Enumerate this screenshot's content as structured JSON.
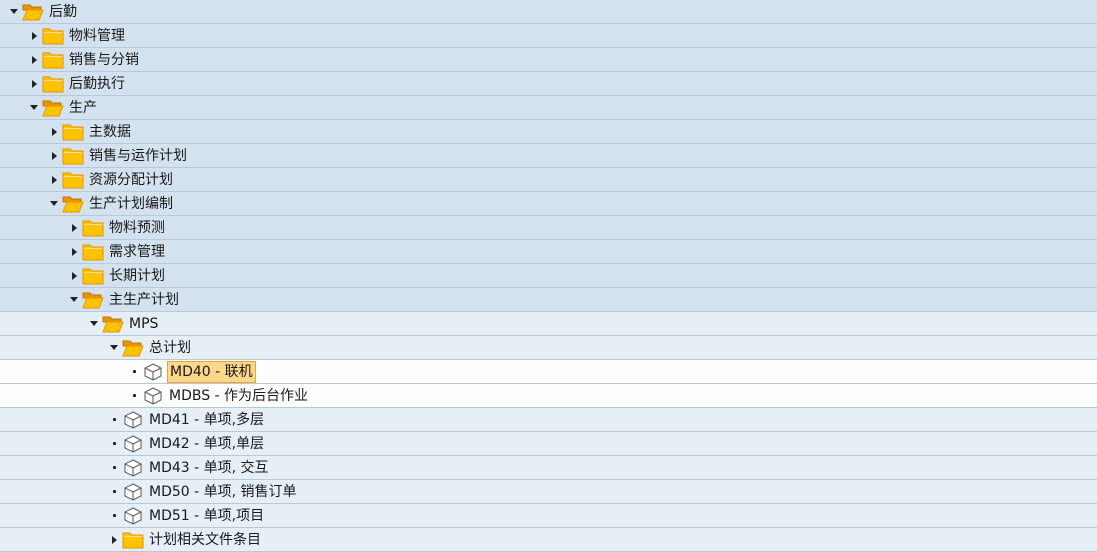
{
  "tree": [
    {
      "label": "后勤",
      "type": "folder",
      "state": "open",
      "level": 0
    },
    {
      "label": "物料管理",
      "type": "folder",
      "state": "closed",
      "level": 1
    },
    {
      "label": "销售与分销",
      "type": "folder",
      "state": "closed",
      "level": 1
    },
    {
      "label": "后勤执行",
      "type": "folder",
      "state": "closed",
      "level": 1
    },
    {
      "label": "生产",
      "type": "folder",
      "state": "open",
      "level": 1
    },
    {
      "label": "主数据",
      "type": "folder",
      "state": "closed",
      "level": 2
    },
    {
      "label": "销售与运作计划",
      "type": "folder",
      "state": "closed",
      "level": 2
    },
    {
      "label": "资源分配计划",
      "type": "folder",
      "state": "closed",
      "level": 2
    },
    {
      "label": "生产计划编制",
      "type": "folder",
      "state": "open",
      "level": 2
    },
    {
      "label": "物料预测",
      "type": "folder",
      "state": "closed",
      "level": 3
    },
    {
      "label": "需求管理",
      "type": "folder",
      "state": "closed",
      "level": 3
    },
    {
      "label": "长期计划",
      "type": "folder",
      "state": "closed",
      "level": 3
    },
    {
      "label": "主生产计划",
      "type": "folder",
      "state": "open",
      "level": 3
    },
    {
      "label": "MPS",
      "type": "folder",
      "state": "open",
      "level": 4
    },
    {
      "label": "总计划",
      "type": "folder",
      "state": "open",
      "level": 5
    },
    {
      "label": "MD40 - 联机",
      "type": "transaction",
      "level": 6,
      "selected": true
    },
    {
      "label": "MDBS - 作为后台作业",
      "type": "transaction",
      "level": 6
    },
    {
      "label": "MD41 - 单项,多层",
      "type": "transaction",
      "level": 5
    },
    {
      "label": "MD42 - 单项,单层",
      "type": "transaction",
      "level": 5
    },
    {
      "label": "MD43 - 单项, 交互",
      "type": "transaction",
      "level": 5
    },
    {
      "label": "MD50 - 单项, 销售订单",
      "type": "transaction",
      "level": 5
    },
    {
      "label": "MD51 - 单项,项目",
      "type": "transaction",
      "level": 5
    },
    {
      "label": "计划相关文件条目",
      "type": "folder",
      "state": "closed",
      "level": 5
    }
  ],
  "colors": {
    "row_blue": "#d4e1ee",
    "row_lightblue": "#e6eef6",
    "row_white": "#fefefe",
    "folder_fill": "#ffc300",
    "folder_dark": "#e59400",
    "selection": "#fdd88a"
  }
}
